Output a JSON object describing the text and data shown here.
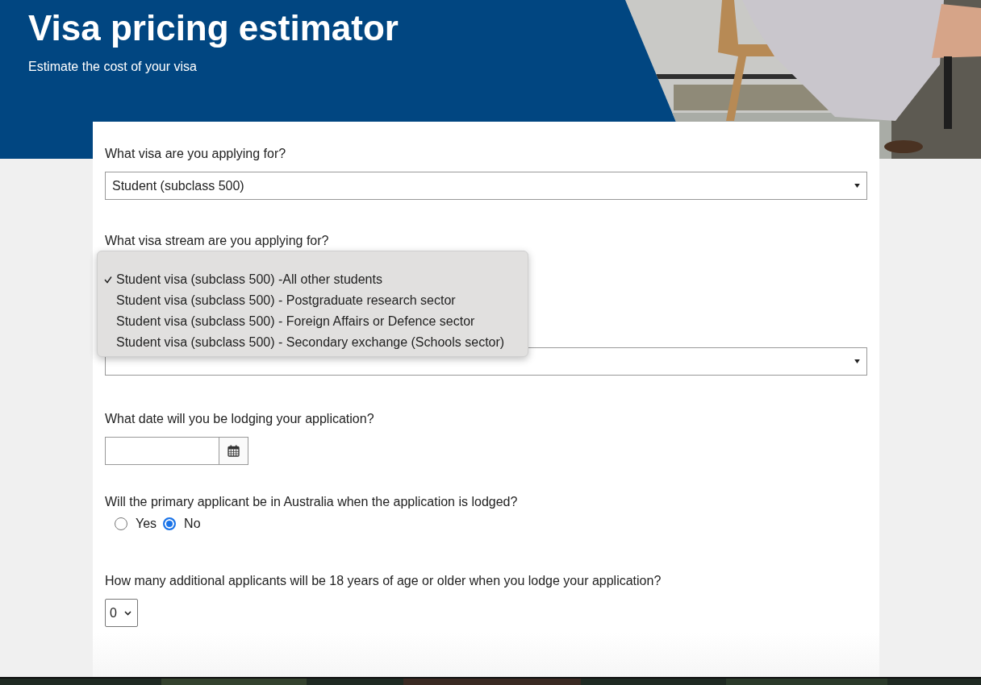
{
  "header": {
    "title": "Visa pricing estimator",
    "subtitle": "Estimate the cost of your visa"
  },
  "form": {
    "questions": [
      {
        "kind": "select",
        "label": "What visa are you applying for?",
        "value": "Student (subclass 500)"
      },
      {
        "kind": "select",
        "label": "What visa stream are you applying for?",
        "menu": {
          "options": [
            {
              "label": "Student visa (subclass 500) -All other students",
              "selected": true
            },
            {
              "label": "Student visa (subclass 500) - Postgraduate research sector",
              "selected": false
            },
            {
              "label": "Student visa (subclass 500) - Foreign Affairs or Defence sector",
              "selected": false
            },
            {
              "label": "Student visa (subclass 500) - Secondary exchange (Schools sector)",
              "selected": false
            }
          ]
        }
      },
      {
        "kind": "date",
        "label": "What date will you be lodging your application?"
      },
      {
        "kind": "radio",
        "label": "Will the primary applicant be in Australia when the application is lodged?",
        "options": [
          {
            "label": "Yes",
            "selected": false
          },
          {
            "label": "No",
            "selected": true
          }
        ]
      },
      {
        "kind": "small_select",
        "label": "How many additional applicants will be 18 years of age or older when you lodge your application?",
        "value": "0"
      }
    ]
  }
}
